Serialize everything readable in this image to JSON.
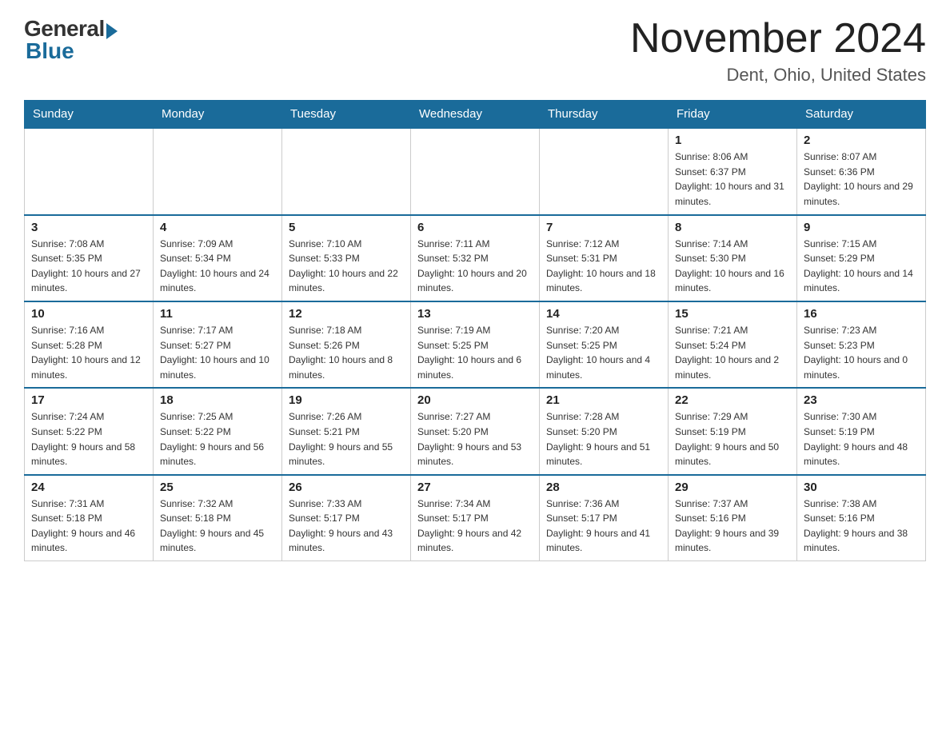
{
  "header": {
    "logo_general": "General",
    "logo_blue": "Blue",
    "main_title": "November 2024",
    "subtitle": "Dent, Ohio, United States"
  },
  "calendar": {
    "days_of_week": [
      "Sunday",
      "Monday",
      "Tuesday",
      "Wednesday",
      "Thursday",
      "Friday",
      "Saturday"
    ],
    "weeks": [
      [
        {
          "day": "",
          "info": ""
        },
        {
          "day": "",
          "info": ""
        },
        {
          "day": "",
          "info": ""
        },
        {
          "day": "",
          "info": ""
        },
        {
          "day": "",
          "info": ""
        },
        {
          "day": "1",
          "info": "Sunrise: 8:06 AM\nSunset: 6:37 PM\nDaylight: 10 hours and 31 minutes."
        },
        {
          "day": "2",
          "info": "Sunrise: 8:07 AM\nSunset: 6:36 PM\nDaylight: 10 hours and 29 minutes."
        }
      ],
      [
        {
          "day": "3",
          "info": "Sunrise: 7:08 AM\nSunset: 5:35 PM\nDaylight: 10 hours and 27 minutes."
        },
        {
          "day": "4",
          "info": "Sunrise: 7:09 AM\nSunset: 5:34 PM\nDaylight: 10 hours and 24 minutes."
        },
        {
          "day": "5",
          "info": "Sunrise: 7:10 AM\nSunset: 5:33 PM\nDaylight: 10 hours and 22 minutes."
        },
        {
          "day": "6",
          "info": "Sunrise: 7:11 AM\nSunset: 5:32 PM\nDaylight: 10 hours and 20 minutes."
        },
        {
          "day": "7",
          "info": "Sunrise: 7:12 AM\nSunset: 5:31 PM\nDaylight: 10 hours and 18 minutes."
        },
        {
          "day": "8",
          "info": "Sunrise: 7:14 AM\nSunset: 5:30 PM\nDaylight: 10 hours and 16 minutes."
        },
        {
          "day": "9",
          "info": "Sunrise: 7:15 AM\nSunset: 5:29 PM\nDaylight: 10 hours and 14 minutes."
        }
      ],
      [
        {
          "day": "10",
          "info": "Sunrise: 7:16 AM\nSunset: 5:28 PM\nDaylight: 10 hours and 12 minutes."
        },
        {
          "day": "11",
          "info": "Sunrise: 7:17 AM\nSunset: 5:27 PM\nDaylight: 10 hours and 10 minutes."
        },
        {
          "day": "12",
          "info": "Sunrise: 7:18 AM\nSunset: 5:26 PM\nDaylight: 10 hours and 8 minutes."
        },
        {
          "day": "13",
          "info": "Sunrise: 7:19 AM\nSunset: 5:25 PM\nDaylight: 10 hours and 6 minutes."
        },
        {
          "day": "14",
          "info": "Sunrise: 7:20 AM\nSunset: 5:25 PM\nDaylight: 10 hours and 4 minutes."
        },
        {
          "day": "15",
          "info": "Sunrise: 7:21 AM\nSunset: 5:24 PM\nDaylight: 10 hours and 2 minutes."
        },
        {
          "day": "16",
          "info": "Sunrise: 7:23 AM\nSunset: 5:23 PM\nDaylight: 10 hours and 0 minutes."
        }
      ],
      [
        {
          "day": "17",
          "info": "Sunrise: 7:24 AM\nSunset: 5:22 PM\nDaylight: 9 hours and 58 minutes."
        },
        {
          "day": "18",
          "info": "Sunrise: 7:25 AM\nSunset: 5:22 PM\nDaylight: 9 hours and 56 minutes."
        },
        {
          "day": "19",
          "info": "Sunrise: 7:26 AM\nSunset: 5:21 PM\nDaylight: 9 hours and 55 minutes."
        },
        {
          "day": "20",
          "info": "Sunrise: 7:27 AM\nSunset: 5:20 PM\nDaylight: 9 hours and 53 minutes."
        },
        {
          "day": "21",
          "info": "Sunrise: 7:28 AM\nSunset: 5:20 PM\nDaylight: 9 hours and 51 minutes."
        },
        {
          "day": "22",
          "info": "Sunrise: 7:29 AM\nSunset: 5:19 PM\nDaylight: 9 hours and 50 minutes."
        },
        {
          "day": "23",
          "info": "Sunrise: 7:30 AM\nSunset: 5:19 PM\nDaylight: 9 hours and 48 minutes."
        }
      ],
      [
        {
          "day": "24",
          "info": "Sunrise: 7:31 AM\nSunset: 5:18 PM\nDaylight: 9 hours and 46 minutes."
        },
        {
          "day": "25",
          "info": "Sunrise: 7:32 AM\nSunset: 5:18 PM\nDaylight: 9 hours and 45 minutes."
        },
        {
          "day": "26",
          "info": "Sunrise: 7:33 AM\nSunset: 5:17 PM\nDaylight: 9 hours and 43 minutes."
        },
        {
          "day": "27",
          "info": "Sunrise: 7:34 AM\nSunset: 5:17 PM\nDaylight: 9 hours and 42 minutes."
        },
        {
          "day": "28",
          "info": "Sunrise: 7:36 AM\nSunset: 5:17 PM\nDaylight: 9 hours and 41 minutes."
        },
        {
          "day": "29",
          "info": "Sunrise: 7:37 AM\nSunset: 5:16 PM\nDaylight: 9 hours and 39 minutes."
        },
        {
          "day": "30",
          "info": "Sunrise: 7:38 AM\nSunset: 5:16 PM\nDaylight: 9 hours and 38 minutes."
        }
      ]
    ]
  }
}
